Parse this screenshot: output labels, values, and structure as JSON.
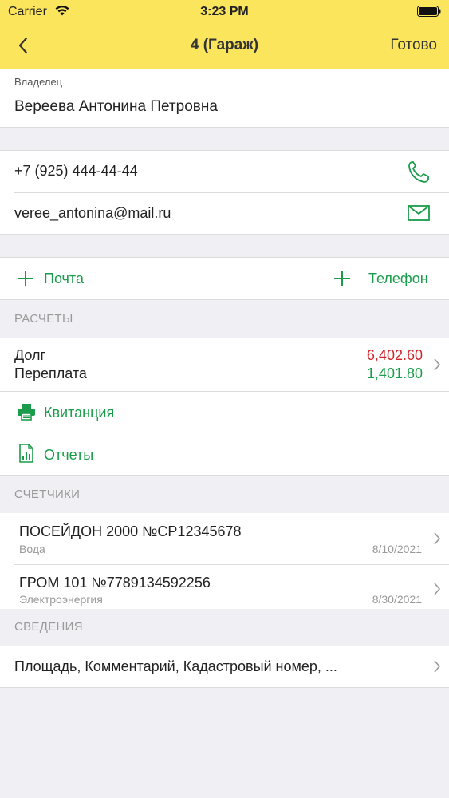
{
  "status_bar": {
    "carrier": "Carrier",
    "time": "3:23 PM"
  },
  "nav": {
    "title": "4 (Гараж)",
    "done_label": "Готово"
  },
  "owner": {
    "label": "Владелец",
    "name": "Вереева Антонина Петровна"
  },
  "contacts": {
    "phone": "+7 (925) 444-44-44",
    "email": "veree_antonina@mail.ru"
  },
  "add_actions": {
    "email_label": "Почта",
    "phone_label": "Телефон"
  },
  "payments": {
    "title": "РАСЧЕТЫ",
    "debt_label": "Долг",
    "debt_value": "6,402.60",
    "overpay_label": "Переплата",
    "overpay_value": "1,401.80",
    "receipt_label": "Квитанция",
    "reports_label": "Отчеты"
  },
  "meters": {
    "title": "СЧЕТЧИКИ",
    "items": [
      {
        "name": "ПОСЕЙДОН 2000 №СР12345678",
        "type": "Вода",
        "date": "8/10/2021"
      },
      {
        "name": "ГРОМ 101 №7789134592256",
        "type": "Электроэнергия",
        "date": "8/30/2021"
      }
    ]
  },
  "info": {
    "title": "СВЕДЕНИЯ",
    "summary": "Площадь, Комментарий, Кадастровый номер, ..."
  },
  "colors": {
    "header": "#fbe55d",
    "accent_green": "#1a9c4a",
    "debt_red": "#d0262b",
    "background": "#efeff4"
  }
}
